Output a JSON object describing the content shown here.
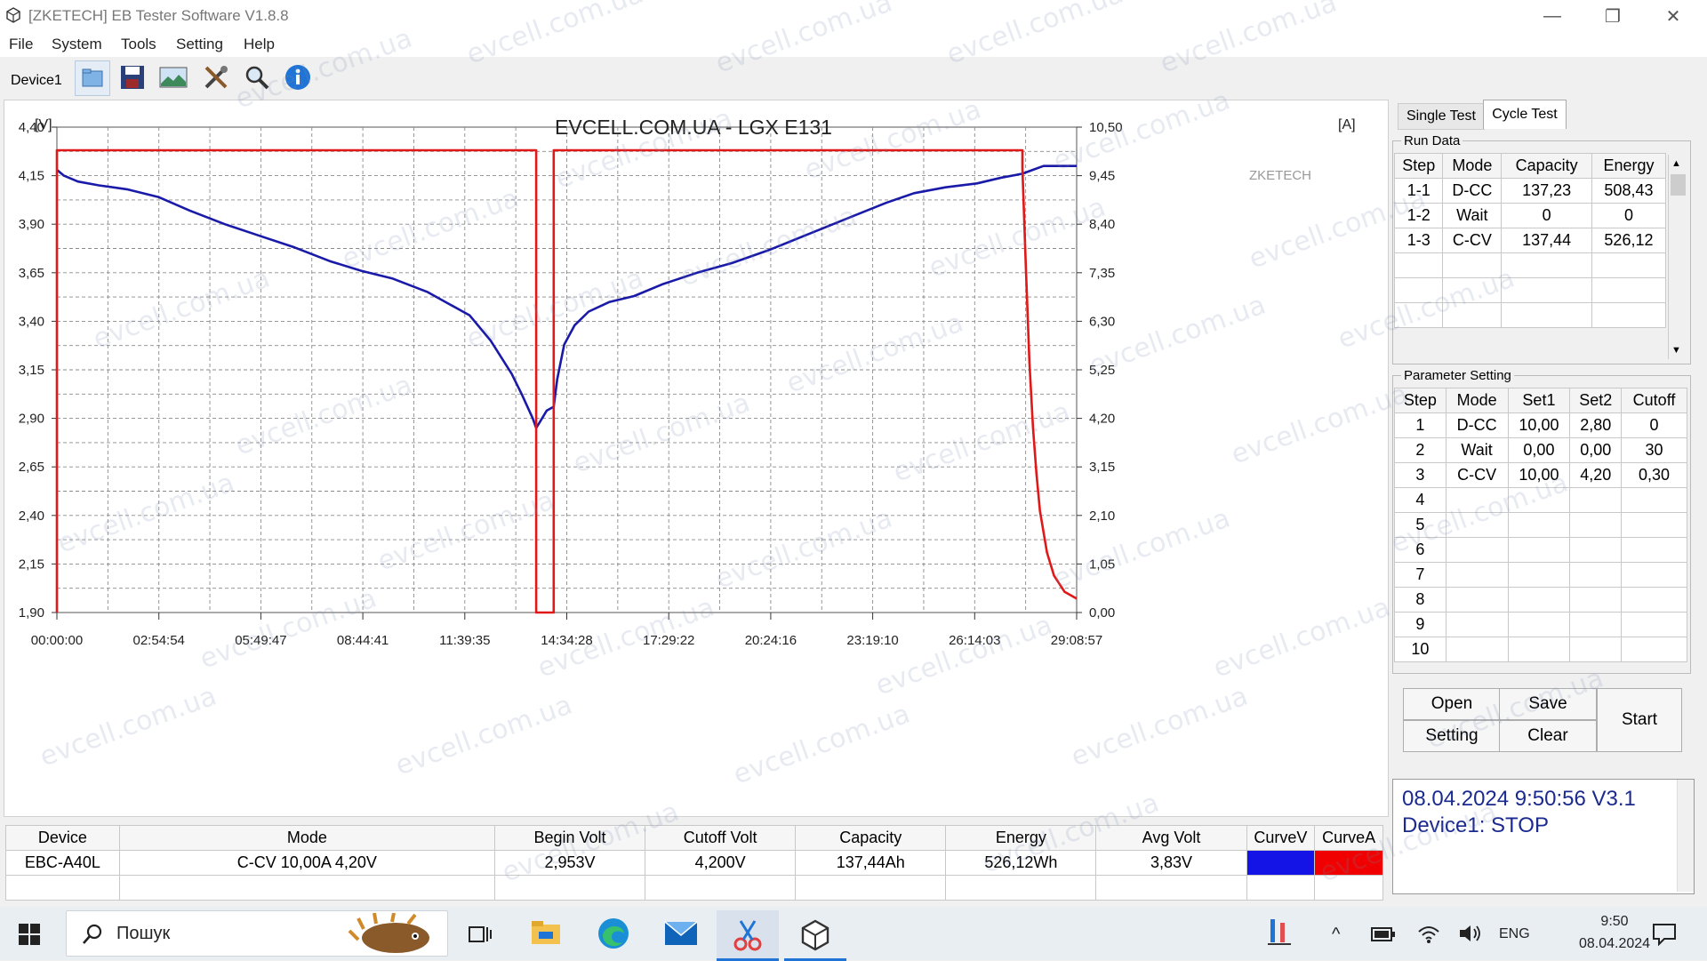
{
  "window": {
    "title": "[ZKETECH] EB Tester Software V1.8.8",
    "controls": {
      "minimize": "—",
      "maximize": "❐",
      "close": "✕"
    }
  },
  "menu": [
    "File",
    "System",
    "Tools",
    "Setting",
    "Help"
  ],
  "toolbar": {
    "device": "Device1",
    "icons": [
      "folder-icon",
      "save-icon",
      "image-icon",
      "tools-icon",
      "search-icon",
      "info-icon"
    ]
  },
  "chart": {
    "title": "EVCELL.COM.UA - LGX E131",
    "left_unit": "[V]",
    "right_unit": "[A]",
    "brand": "ZKETECH",
    "voltage_ticks": [
      "4,40",
      "4,15",
      "3,90",
      "3,65",
      "3,40",
      "3,15",
      "2,90",
      "2,65",
      "2,40",
      "2,15",
      "1,90"
    ],
    "current_ticks": [
      "10,50",
      "9,45",
      "8,40",
      "7,35",
      "6,30",
      "5,25",
      "4,20",
      "3,15",
      "2,10",
      "1,05",
      "0,00"
    ],
    "time_ticks": [
      "00:00:00",
      "02:54:54",
      "05:49:47",
      "08:44:41",
      "11:39:35",
      "14:34:28",
      "17:29:22",
      "20:24:16",
      "23:19:10",
      "26:14:03",
      "29:08:57"
    ]
  },
  "chart_data": {
    "type": "line",
    "title": "EVCELL.COM.UA - LGX E131",
    "x_unit": "hours",
    "xlim": [
      0,
      29.149
    ],
    "y_left": {
      "label": "[V]",
      "lim": [
        1.9,
        4.4
      ]
    },
    "y_right": {
      "label": "[A]",
      "lim": [
        0.0,
        10.5
      ]
    },
    "grid": true,
    "series": [
      {
        "name": "CurveV",
        "axis": "left",
        "color": "#1a1aa8",
        "x": [
          0.0,
          0.2,
          0.6,
          1.2,
          2.0,
          2.9,
          3.8,
          4.8,
          5.8,
          6.8,
          7.8,
          8.7,
          9.6,
          10.6,
          11.2,
          11.8,
          12.4,
          13.0,
          13.3,
          13.6,
          13.7,
          13.9,
          14.0,
          14.1,
          14.2,
          14.3,
          14.5,
          14.8,
          15.2,
          15.8,
          16.5,
          17.3,
          18.3,
          19.3,
          20.4,
          21.5,
          22.6,
          23.7,
          24.5,
          25.4,
          26.3,
          27.0,
          27.6,
          27.9,
          28.2,
          29.15
        ],
        "values": [
          4.18,
          4.15,
          4.12,
          4.1,
          4.08,
          4.04,
          3.97,
          3.9,
          3.84,
          3.78,
          3.71,
          3.66,
          3.62,
          3.55,
          3.49,
          3.43,
          3.3,
          3.13,
          3.02,
          2.9,
          2.85,
          2.91,
          2.94,
          2.95,
          2.96,
          3.1,
          3.28,
          3.38,
          3.45,
          3.5,
          3.53,
          3.59,
          3.65,
          3.7,
          3.77,
          3.85,
          3.93,
          4.01,
          4.06,
          4.09,
          4.11,
          4.14,
          4.16,
          4.18,
          4.2,
          4.2
        ]
      },
      {
        "name": "CurveA",
        "axis": "right",
        "color": "#e01818",
        "x": [
          0.0,
          0.0,
          13.7,
          13.7,
          14.2,
          14.2,
          27.6,
          27.6,
          27.7,
          27.8,
          27.9,
          28.0,
          28.1,
          28.3,
          28.5,
          28.8,
          29.15
        ],
        "values": [
          0.0,
          10.0,
          10.0,
          0.0,
          0.0,
          10.0,
          10.0,
          9.6,
          7.4,
          5.4,
          4.0,
          3.0,
          2.2,
          1.3,
          0.8,
          0.45,
          0.3
        ]
      }
    ]
  },
  "tabs": {
    "single": "Single Test",
    "cycle": "Cycle Test"
  },
  "run_data": {
    "title": "Run Data",
    "headers": [
      "Step",
      "Mode",
      "Capacity",
      "Energy"
    ],
    "rows": [
      [
        "1-1",
        "D-CC",
        "137,23",
        "508,43"
      ],
      [
        "1-2",
        "Wait",
        "0",
        "0"
      ],
      [
        "1-3",
        "C-CV",
        "137,44",
        "526,12"
      ],
      [
        "",
        "",
        "",
        ""
      ],
      [
        "",
        "",
        "",
        ""
      ],
      [
        "",
        "",
        "",
        ""
      ]
    ]
  },
  "param_setting": {
    "title": "Parameter Setting",
    "headers": [
      "Step",
      "Mode",
      "Set1",
      "Set2",
      "Cutoff"
    ],
    "rows": [
      [
        "1",
        "D-CC",
        "10,00",
        "2,80",
        "0"
      ],
      [
        "2",
        "Wait",
        "0,00",
        "0,00",
        "30"
      ],
      [
        "3",
        "C-CV",
        "10,00",
        "4,20",
        "0,30"
      ],
      [
        "4",
        "",
        "",
        "",
        ""
      ],
      [
        "5",
        "",
        "",
        "",
        ""
      ],
      [
        "6",
        "",
        "",
        "",
        ""
      ],
      [
        "7",
        "",
        "",
        "",
        ""
      ],
      [
        "8",
        "",
        "",
        "",
        ""
      ],
      [
        "9",
        "",
        "",
        "",
        ""
      ],
      [
        "10",
        "",
        "",
        "",
        ""
      ]
    ]
  },
  "buttons": {
    "open": "Open",
    "save": "Save",
    "setting": "Setting",
    "clear": "Clear",
    "start": "Start"
  },
  "status": {
    "line1": "08.04.2024 9:50:56  V3.1",
    "line2": "Device1: STOP"
  },
  "summary": {
    "headers": [
      "Device",
      "Mode",
      "Begin Volt",
      "Cutoff Volt",
      "Capacity",
      "Energy",
      "Avg Volt",
      "CurveV",
      "CurveA"
    ],
    "row": [
      "EBC-A40L",
      "C-CV  10,00A  4,20V",
      "2,953V",
      "4,200V",
      "137,44Ah",
      "526,12Wh",
      "3,83V"
    ],
    "curve_colors": {
      "v": "#1414e6",
      "a": "#f00000"
    }
  },
  "taskbar": {
    "search": "Пошук",
    "lang": "ENG",
    "time": "9:50",
    "date": "08.04.2024"
  },
  "watermark": "evcell.com.ua"
}
